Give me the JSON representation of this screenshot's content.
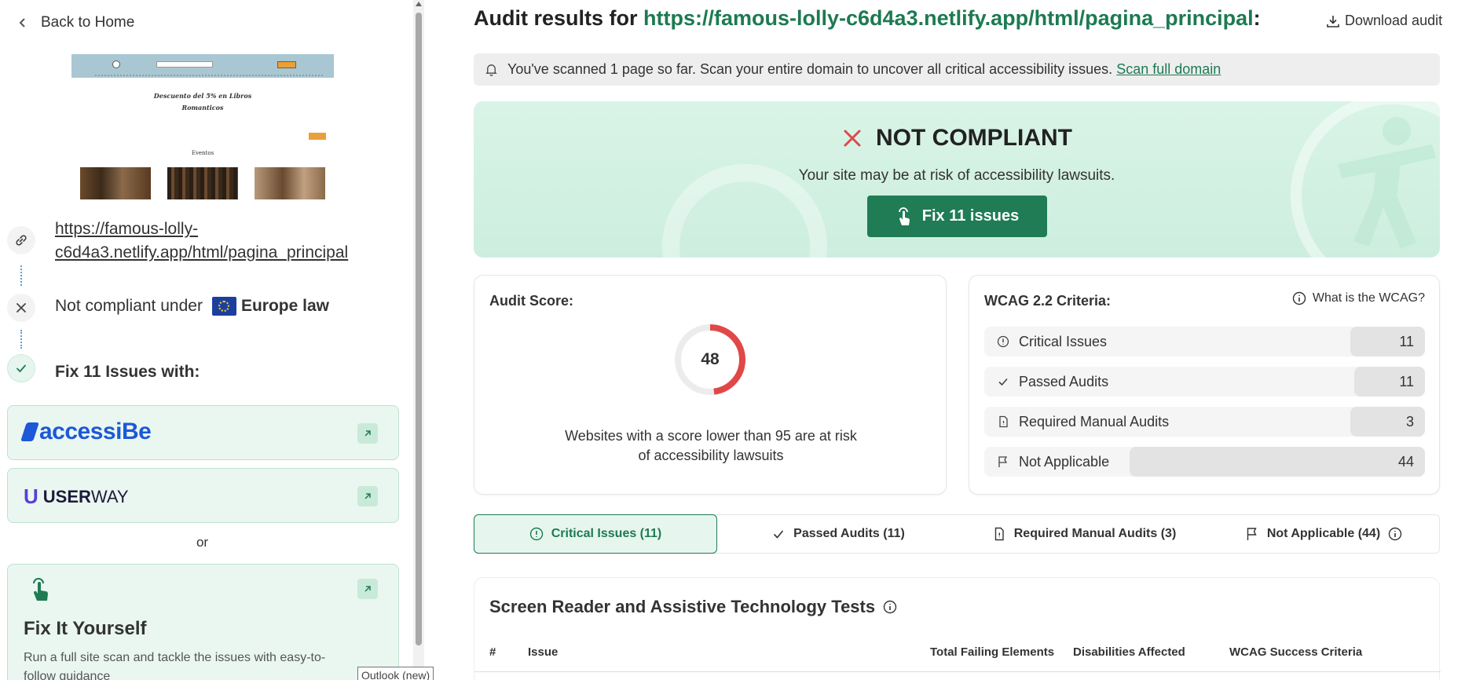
{
  "sidebar": {
    "back_label": "Back to Home",
    "thumbnail": {
      "title": "Descuento del 5% en Libros Romanticos",
      "section": "Eventos"
    },
    "site_url": "https://famous-lolly-c6d4a3.netlify.app/html/pagina_principal",
    "compliance": {
      "prefix": "Not compliant under",
      "law": "Europe law"
    },
    "fix_with_label": "Fix 11 Issues with:",
    "providers": [
      {
        "name": "accessiBe",
        "logo_text": "accessiBe",
        "color": "#1c58d8"
      },
      {
        "name": "UserWay",
        "logo_bold": "USER",
        "logo_rest": "WAY",
        "color": "#5a3ed8"
      }
    ],
    "or_label": "or",
    "fix_yourself": {
      "title": "Fix It Yourself",
      "description": "Run a full site scan and tackle the issues with easy-to-follow guidance"
    }
  },
  "tooltip": "Outlook (new)",
  "main": {
    "title_prefix": "Audit results for",
    "title_url": "https://famous-lolly-c6d4a3.netlify.app/html/pagina_principal",
    "title_suffix": ":",
    "download_label": "Download audit",
    "notice": {
      "text": "You've scanned 1 page so far. Scan your entire domain to uncover all critical accessibility issues.",
      "link": "Scan full domain"
    },
    "hero": {
      "status": "NOT COMPLIANT",
      "subtitle": "Your site may be at risk of accessibility lawsuits.",
      "button": "Fix 11 issues"
    },
    "score_card": {
      "title": "Audit Score:",
      "score": 48,
      "score_max": 100,
      "text": "Websites with a score lower than 95 are at risk of accessibility lawsuits"
    },
    "wcag_card": {
      "title": "WCAG 2.2 Criteria:",
      "help": "What is the WCAG?",
      "rows": [
        {
          "label": "Critical Issues",
          "value": "11",
          "icon": "alert-circle-icon"
        },
        {
          "label": "Passed Audits",
          "value": "11",
          "icon": "check-icon"
        },
        {
          "label": "Required Manual Audits",
          "value": "3",
          "icon": "document-icon"
        },
        {
          "label": "Not Applicable",
          "value": "44",
          "icon": "flag-icon"
        }
      ]
    },
    "tabs": [
      {
        "label": "Critical Issues (11)",
        "icon": "alert-circle-icon",
        "active": true
      },
      {
        "label": "Passed Audits (11)",
        "icon": "check-icon",
        "active": false
      },
      {
        "label": "Required Manual Audits (3)",
        "icon": "document-icon",
        "active": false
      },
      {
        "label": "Not Applicable (44)",
        "icon": "flag-icon",
        "active": false
      }
    ],
    "section": {
      "title": "Screen Reader and Assistive Technology Tests",
      "columns": [
        "#",
        "Issue",
        "Total Failing Elements",
        "Disabilities Affected",
        "WCAG Success Criteria"
      ]
    }
  },
  "colors": {
    "brand_green": "#1f7c55",
    "link_green": "#1d7a52",
    "danger_red": "#e04848",
    "hero_bg": "#d3f1e3"
  }
}
